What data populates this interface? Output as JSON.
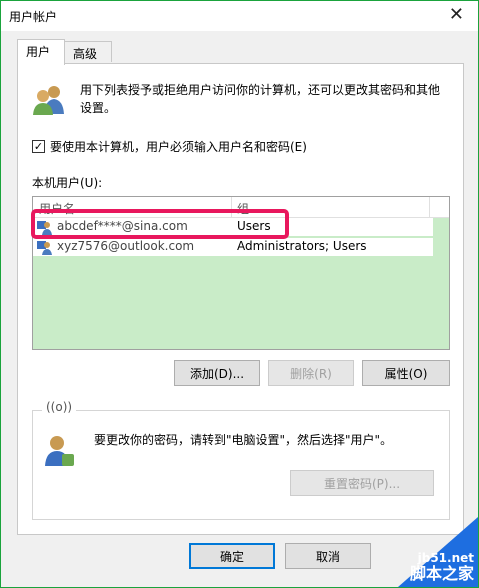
{
  "window": {
    "title": "用户帐户",
    "close_glyph": "✕"
  },
  "tabs": [
    {
      "label": "用户",
      "active": true
    },
    {
      "label": "高级",
      "active": false
    }
  ],
  "intro_text": "用下列表授予或拒绝用户访问你的计算机，还可以更改其密码和其他设置。",
  "require_password": {
    "checked": true,
    "check_glyph": "✓",
    "label": "要使用本计算机，用户必须输入用户名和密码(E)"
  },
  "users_list": {
    "label": "本机用户(U):",
    "columns": [
      "用户名",
      "组"
    ],
    "rows": [
      {
        "name": "abcdef****@sina.com",
        "group": "Users"
      },
      {
        "name": "xyz7576@outlook.com",
        "group": "Administrators; Users"
      }
    ]
  },
  "buttons": {
    "add": "添加(D)...",
    "remove": "删除(R)",
    "properties": "属性(O)"
  },
  "password_group": {
    "caption": "((o))",
    "text": "要更改你的密码，请转到\"电脑设置\"，然后选择\"用户\"。",
    "reset_button": "重置密码(P)..."
  },
  "footer": {
    "ok": "确定",
    "cancel": "取消"
  },
  "watermark": {
    "site": "jb51.net",
    "name": "脚本之家"
  },
  "colors": {
    "border": "#1aa33c",
    "highlight": "#e8175d",
    "list_bg": "#c9ecc8",
    "accent": "#0078d7"
  }
}
